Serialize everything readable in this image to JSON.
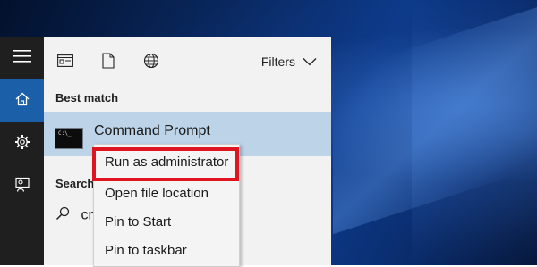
{
  "start_menu": {
    "toolbar": {
      "icons": [
        "apps-icon",
        "document-icon",
        "web-globe-icon"
      ],
      "filters_label": "Filters"
    },
    "best_match": {
      "section_label": "Best match",
      "item_title": "Command Prompt",
      "item_icon": "command-prompt-icon"
    },
    "search": {
      "section_label": "Search",
      "query_partial": "cm"
    },
    "rail": {
      "icons": [
        "hamburger-menu-icon",
        "home-icon",
        "settings-gear-icon",
        "feedback-icon"
      ]
    }
  },
  "context_menu": {
    "items": [
      {
        "label": "Run as administrator",
        "highlighted": true
      },
      {
        "label": "Open file location"
      },
      {
        "label": "Pin to Start"
      },
      {
        "label": "Pin to taskbar"
      }
    ],
    "highlight_color": "#e0141e"
  },
  "colors": {
    "selected_row": "#bcd3e8",
    "rail_background": "#1f1f1f",
    "rail_active": "#1b5fa8",
    "panel_background": "#f2f2f2"
  }
}
